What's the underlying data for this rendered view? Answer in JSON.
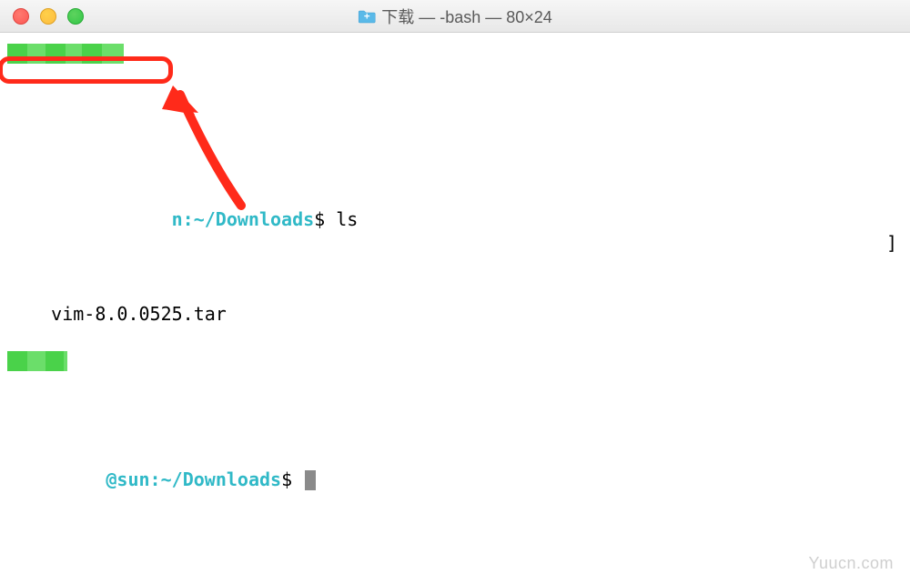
{
  "window": {
    "title": "下载 — -bash — 80×24"
  },
  "terminal": {
    "line1": {
      "user_masked": "   ",
      "host_prefix": "n:",
      "path": "~/Downloads",
      "dollar": "$",
      "command": "ls",
      "right_char": "]"
    },
    "output": {
      "filename": "vim-8.0.0525.tar"
    },
    "line2": {
      "user_masked": "    ",
      "at": "@sun:",
      "path": "~/Downloads",
      "dollar": "$"
    }
  },
  "watermark": "Yuucn.com",
  "colors": {
    "highlight": "#ff2a1a",
    "arrow": "#ff2a1a",
    "prompt_cyan": "#30b9c7",
    "censor_green": "#6bde6a"
  }
}
